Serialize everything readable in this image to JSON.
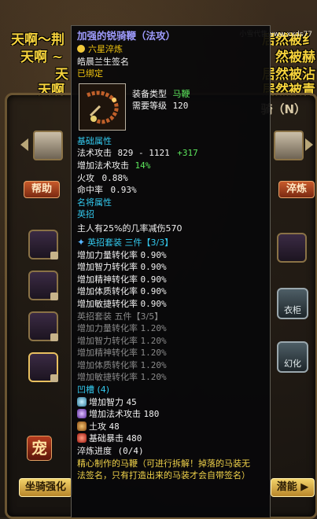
{
  "announcements": [
    {
      "left": "天啊～荆",
      "right": "居然被纟"
    },
    {
      "left": "天啊 ~",
      "right": "然被赫"
    },
    {
      "left": "天",
      "right": "居然被沾"
    },
    {
      "left": "天啊",
      "right": "居然被青"
    }
  ],
  "watermark": "小雪代售www.xxds77",
  "background": {
    "mount_title": "骑（N）",
    "help_button": "帮助",
    "refine_button": "淬炼",
    "right_icon_1": "衣柜",
    "right_icon_2": "幻化",
    "bottom_left_button": "坐骑强化",
    "bottom_right_button": "潜能 ▶",
    "pet_char": "宠"
  },
  "tooltip": {
    "title": "加强的锐骑鞭（法攻）",
    "refine_level": "六星淬炼",
    "signature": "皓晨兰生签名",
    "bound": "已绑定",
    "equip_type_label": "装备类型",
    "equip_type_value": "马鞭",
    "req_level_label": "需要等级",
    "req_level_value": "120",
    "base_attr_header": "基础属性",
    "base_attrs": [
      {
        "label": "法术攻击",
        "value": "829 - 1121",
        "bonus": "+317"
      },
      {
        "label": "增加法术攻击",
        "value": "14%",
        "bonus": ""
      },
      {
        "label": "火攻",
        "value": "0.88%",
        "bonus": ""
      },
      {
        "label": "命中率",
        "value": "0.93%",
        "bonus": ""
      }
    ],
    "famous_header": "名将属性",
    "hero_move_header": "英招",
    "hero_move_desc": "主人有25%的几率减伤570",
    "set3_header": "英招套装  三件【3/3】",
    "set3_lines": [
      {
        "label": "增加力量转化率",
        "value": "0.90%"
      },
      {
        "label": "增加智力转化率",
        "value": "0.90%"
      },
      {
        "label": "增加精神转化率",
        "value": "0.90%"
      },
      {
        "label": "增加体质转化率",
        "value": "0.90%"
      },
      {
        "label": "增加敏捷转化率",
        "value": "0.90%"
      }
    ],
    "set5_header": "英招套装  五件【3/5】",
    "set5_lines": [
      {
        "label": "增加力量转化率",
        "value": "1.20%"
      },
      {
        "label": "增加智力转化率",
        "value": "1.20%"
      },
      {
        "label": "增加精神转化率",
        "value": "1.20%"
      },
      {
        "label": "增加体质转化率",
        "value": "1.20%"
      },
      {
        "label": "增加敏捷转化率",
        "value": "1.20%"
      }
    ],
    "groove_header": "凹槽  (4)",
    "groove_lines": [
      {
        "icon": "intelligence-gem-icon",
        "label": "增加智力",
        "value": "45"
      },
      {
        "icon": "magic-attack-gem-icon",
        "label": "增加法术攻击",
        "value": "180"
      },
      {
        "icon": "earth-attack-gem-icon",
        "label": "土攻",
        "value": "48"
      },
      {
        "icon": "critical-gem-icon",
        "label": "基础暴击",
        "value": "480"
      }
    ],
    "refine_progress_label": "淬炼进度",
    "refine_progress_value": "(0/4)",
    "footer_desc_1": "精心制作的马鞭（可进行拆解！掉落的马装无",
    "footer_desc_2": "法签名，只有打造出来的马装才会自带签名）"
  },
  "colors": {
    "title": "#9f9cff",
    "gold": "#f1c40f",
    "green": "#5ce65c",
    "cyan": "#33c9ee",
    "gray": "#8a8a8a"
  }
}
